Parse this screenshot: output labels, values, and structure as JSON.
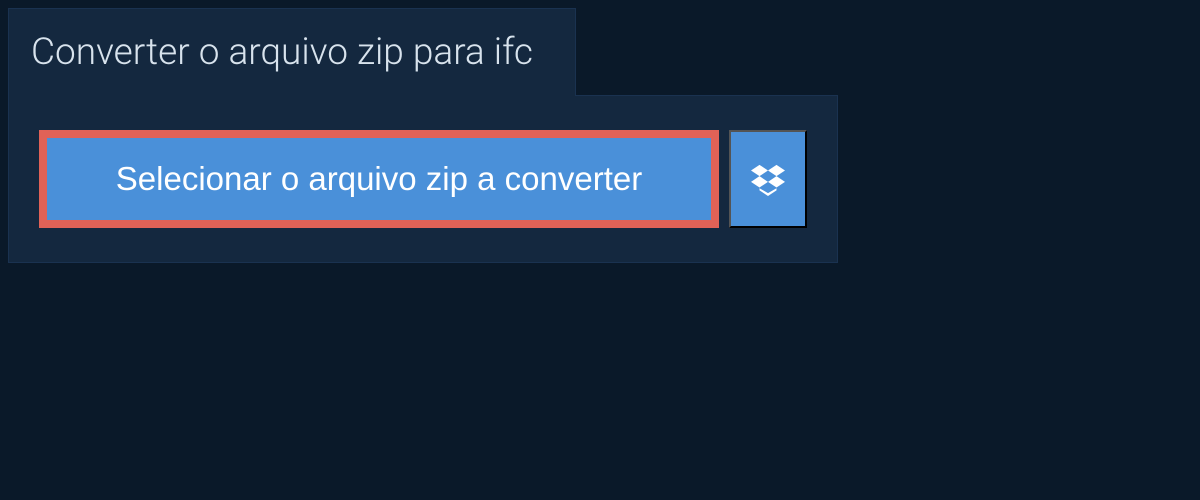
{
  "header": {
    "title": "Converter o arquivo zip para ifc"
  },
  "actions": {
    "select_file_label": "Selecionar o arquivo zip a converter",
    "dropbox_icon_name": "dropbox"
  },
  "colors": {
    "background": "#0a1929",
    "panel": "#14283f",
    "primary_button": "#4a90d9",
    "highlight_border": "#e06257",
    "text_light": "#d8e3ed"
  }
}
